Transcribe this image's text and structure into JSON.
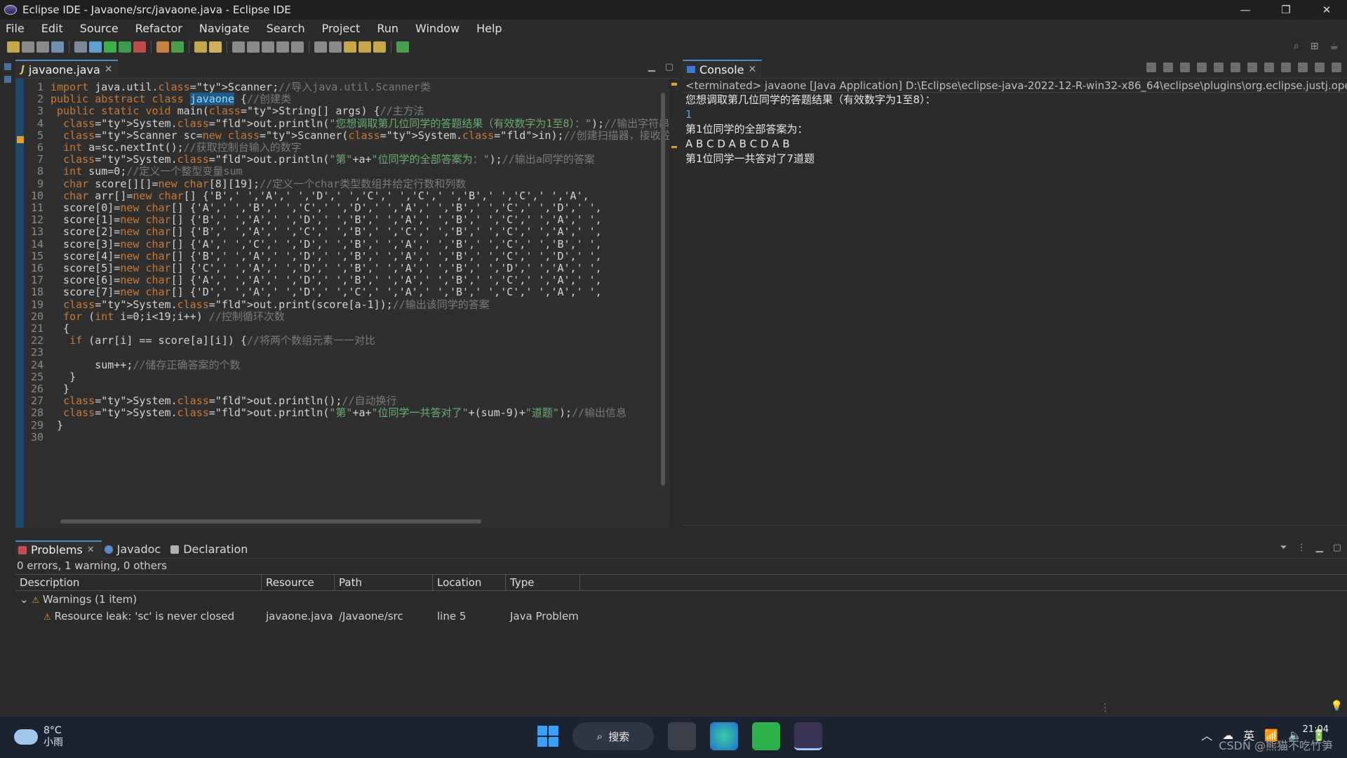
{
  "window": {
    "title": "Eclipse IDE - Javaone/src/javaone.java - Eclipse IDE",
    "minimize": "—",
    "restore": "❐",
    "close": "✕"
  },
  "menu": [
    "File",
    "Edit",
    "Source",
    "Refactor",
    "Navigate",
    "Search",
    "Project",
    "Run",
    "Window",
    "Help"
  ],
  "editor": {
    "tab_label": "javaone.java",
    "line_numbers": [
      "1",
      "2",
      "3",
      "4",
      "5",
      "6",
      "7",
      "8",
      "9",
      "10",
      "11",
      "12",
      "13",
      "14",
      "15",
      "16",
      "17",
      "18",
      "19",
      "20",
      "21",
      "22",
      "23",
      "24",
      "25",
      "26",
      "27",
      "28",
      "29",
      "30"
    ],
    "code_lines": [
      "import java.util.Scanner;//导入java.util.Scanner类",
      "public abstract class javaone {//创建类",
      " public static void main(String[] args) {//主方法",
      "  System.out.println(\"您想调取第几位同学的答题结果（有效数字为1至8）：\");//输出字符串",
      "  Scanner sc=new Scanner(System.in);//创建扫描器，接收控制台输入内容",
      "  int a=sc.nextInt();//获取控制台输入的数字",
      "  System.out.println(\"第\"+a+\"位同学的全部答案为：\");//输出a同学的答案",
      "  int sum=0;//定义一个整型变量sum",
      "  char score[][]=new char[8][19];//定义一个char类型数组并给定行数和列数",
      "  char arr[]=new char[] {'B',' ','A',' ','D',' ','C',' ','C',' ','B',' ','C',' ','A',",
      "  score[0]=new char[] {'A',' ','B',' ','C',' ','D',' ','A',' ','B',' ','C',' ','D',' ',",
      "  score[1]=new char[] {'B',' ','A',' ','D',' ','B',' ','A',' ','B',' ','C',' ','A',' ',",
      "  score[2]=new char[] {'B',' ','A',' ','C',' ','B',' ','C',' ','B',' ','C',' ','A',' ',",
      "  score[3]=new char[] {'A',' ','C',' ','D',' ','B',' ','A',' ','B',' ','C',' ','B',' ',",
      "  score[4]=new char[] {'B',' ','A',' ','D',' ','B',' ','A',' ','B',' ','C',' ','D',' ',",
      "  score[5]=new char[] {'C',' ','A',' ','D',' ','B',' ','A',' ','B',' ','D',' ','A',' ',",
      "  score[6]=new char[] {'A',' ','A',' ','D',' ','B',' ','A',' ','B',' ','C',' ','A',' ',",
      "  score[7]=new char[] {'D',' ','A',' ','D',' ','C',' ','A',' ','B',' ','C',' ','A',' ',",
      "  System.out.print(score[a-1]);//输出该同学的答案",
      "  for (int i=0;i<19;i++) //控制循环次数",
      "  {",
      "   if (arr[i] == score[a][i]) {//将两个数组元素一一对比",
      "",
      "       sum++;//储存正确答案的个数",
      "   }",
      "  }",
      "  System.out.println();//自动换行",
      "  System.out.println(\"第\"+a+\"位同学一共答对了\"+(sum-9)+\"道题\");//输出信息",
      " }",
      ""
    ]
  },
  "console": {
    "tab_label": "Console",
    "header": "<terminated> javaone [Java Application] D:\\Eclipse\\eclipse-java-2022-12-R-win32-x86_64\\eclipse\\plugins\\org.eclipse.justj.openjdk",
    "lines": [
      {
        "text": "您想调取第几位同学的答题结果（有效数字为1至8）：",
        "type": "out"
      },
      {
        "text": "1",
        "type": "input"
      },
      {
        "text": "第1位同学的全部答案为：",
        "type": "out"
      },
      {
        "text": "A B C D A B C D A B",
        "type": "out"
      },
      {
        "text": "第1位同学一共答对了7道题",
        "type": "out"
      }
    ]
  },
  "problems": {
    "tabs": [
      "Problems",
      "Javadoc",
      "Declaration"
    ],
    "summary": "0 errors, 1 warning, 0 others",
    "columns": [
      "Description",
      "Resource",
      "Path",
      "Location",
      "Type"
    ],
    "group_label": "Warnings (1 item)",
    "rows": [
      {
        "description": "Resource leak: 'sc' is never closed",
        "resource": "javaone.java",
        "path": "/Javaone/src",
        "location": "line 5",
        "type": "Java Problem"
      }
    ]
  },
  "taskbar": {
    "weather_temp": "8°C",
    "weather_desc": "小雨",
    "search_label": "搜索",
    "ime": "英",
    "time": "21:04",
    "watermark": "CSDN @熊猫不吃竹笋"
  },
  "colors": {
    "accent": "#4a88c7",
    "warning": "#e0a12a",
    "string": "#6aab73",
    "keyword": "#cc7832",
    "type": "#4ec9b0",
    "comment": "#7a7a7a"
  }
}
